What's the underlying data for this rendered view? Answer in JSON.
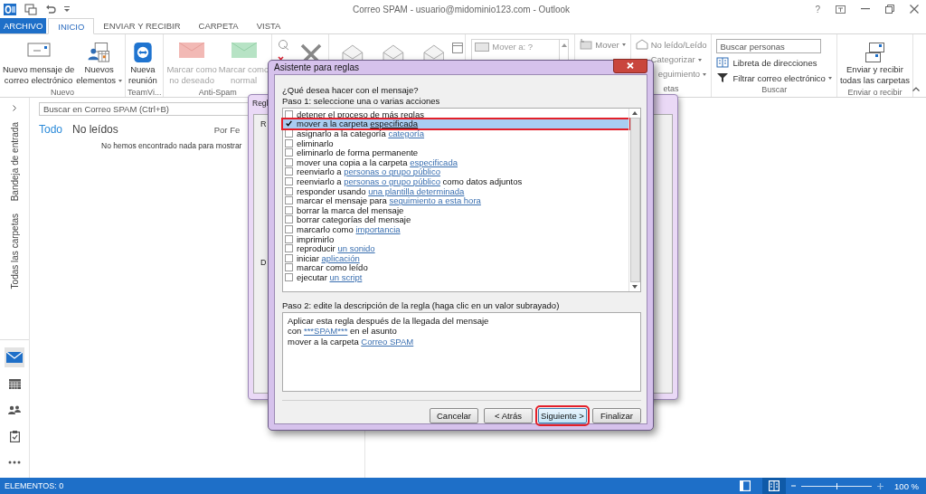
{
  "window": {
    "title": "Correo SPAM - usuario@midominio123.com - Outlook",
    "help": "?"
  },
  "tabs": [
    {
      "label": "ARCHIVO",
      "kind": "backstage",
      "selected": false
    },
    {
      "label": "INICIO",
      "kind": "tab",
      "selected": true
    },
    {
      "label": "ENVIAR Y RECIBIR",
      "kind": "tab",
      "selected": false
    },
    {
      "label": "CARPETA",
      "kind": "tab",
      "selected": false
    },
    {
      "label": "VISTA",
      "kind": "tab",
      "selected": false
    }
  ],
  "ribbon": [
    {
      "kind": "large",
      "label": "Nuevo",
      "buttons": [
        {
          "lines": [
            "Nuevo mensaje de",
            "correo electrónico"
          ],
          "dropdown": false,
          "disabled": false
        },
        {
          "lines": [
            "Nuevos",
            "elementos"
          ],
          "dropdown": true,
          "disabled": false
        }
      ]
    },
    {
      "kind": "large",
      "label": "TeamVi...",
      "buttons": [
        {
          "lines": [
            "Nueva",
            "reunión"
          ],
          "dropdown": false,
          "disabled": false
        }
      ]
    },
    {
      "kind": "large",
      "label": "Anti-Spam",
      "buttons": [
        {
          "lines": [
            "Marcar como",
            "no deseado"
          ],
          "dropdown": false,
          "disabled": true
        },
        {
          "lines": [
            "Marcar como",
            "normal"
          ],
          "dropdown": false,
          "disabled": true
        }
      ]
    },
    {
      "kind": "delete"
    },
    {
      "kind": "respond"
    },
    {
      "kind": "quicksteps",
      "items": [
        "Mover a: ?"
      ]
    },
    {
      "kind": "small",
      "items": [
        {
          "label": "Mover",
          "dropdown": true
        }
      ]
    },
    {
      "kind": "small",
      "label": "etas",
      "items": [
        {
          "label": "No leído/Leído",
          "dropdown": false
        },
        {
          "label": "Categorizar",
          "dropdown": true
        },
        {
          "label": "eguimiento",
          "dropdown": true
        }
      ]
    },
    {
      "kind": "search",
      "label": "Buscar",
      "placeholder": "Buscar personas",
      "items": [
        {
          "label": "Libreta de direcciones",
          "dropdown": false
        },
        {
          "label": "Filtrar correo electrónico",
          "dropdown": true
        }
      ]
    },
    {
      "kind": "large",
      "label": "Enviar o recibir",
      "buttons": [
        {
          "lines": [
            "Enviar y recibir",
            "todas las carpetas"
          ],
          "dropdown": false,
          "disabled": false
        }
      ]
    }
  ],
  "sidebar": {
    "labels": [
      "Bandeja de entrada",
      "Todas las carpetas"
    ],
    "nav": [
      {
        "selected": true
      },
      {
        "selected": false
      },
      {
        "selected": false
      },
      {
        "selected": false
      },
      {
        "selected": false
      }
    ]
  },
  "message_list": {
    "search_placeholder": "Buscar en Correo SPAM (Ctrl+B)",
    "filters": [
      {
        "label": "Todo",
        "selected": true
      },
      {
        "label": "No leídos",
        "selected": false
      }
    ],
    "sort": "Por Fe",
    "empty": "No hemos encontrado nada para mostrar"
  },
  "background_dialog": {
    "title": "Regl",
    "labels": [
      "R",
      "D"
    ]
  },
  "dialog": {
    "title": "Asistente para reglas",
    "question": "¿Qué desea hacer con el mensaje?",
    "step1": "Paso 1: seleccione una o varias acciones",
    "actions": [
      {
        "checked": false,
        "selected": false,
        "annotated": false,
        "parts": [
          {
            "kind": "text",
            "text": "detener el proceso de más reglas"
          }
        ]
      },
      {
        "checked": true,
        "selected": true,
        "annotated": true,
        "parts": [
          {
            "kind": "text",
            "text": "mover a la carpeta "
          },
          {
            "kind": "link",
            "text": "especificada"
          }
        ]
      },
      {
        "checked": false,
        "selected": false,
        "annotated": false,
        "parts": [
          {
            "kind": "text",
            "text": "asignarlo a la categoría "
          },
          {
            "kind": "link",
            "text": "categoría"
          }
        ]
      },
      {
        "checked": false,
        "selected": false,
        "annotated": false,
        "parts": [
          {
            "kind": "text",
            "text": "eliminarlo"
          }
        ]
      },
      {
        "checked": false,
        "selected": false,
        "annotated": false,
        "parts": [
          {
            "kind": "text",
            "text": "eliminarlo de forma permanente"
          }
        ]
      },
      {
        "checked": false,
        "selected": false,
        "annotated": false,
        "parts": [
          {
            "kind": "text",
            "text": "mover una copia a la carpeta "
          },
          {
            "kind": "link",
            "text": "especificada"
          }
        ]
      },
      {
        "checked": false,
        "selected": false,
        "annotated": false,
        "parts": [
          {
            "kind": "text",
            "text": "reenviarlo a "
          },
          {
            "kind": "link",
            "text": "personas o grupo público"
          }
        ]
      },
      {
        "checked": false,
        "selected": false,
        "annotated": false,
        "parts": [
          {
            "kind": "text",
            "text": "reenviarlo a "
          },
          {
            "kind": "link",
            "text": "personas o grupo público"
          },
          {
            "kind": "text",
            "text": " como datos adjuntos"
          }
        ]
      },
      {
        "checked": false,
        "selected": false,
        "annotated": false,
        "parts": [
          {
            "kind": "text",
            "text": "responder usando "
          },
          {
            "kind": "link",
            "text": "una plantilla determinada"
          }
        ]
      },
      {
        "checked": false,
        "selected": false,
        "annotated": false,
        "parts": [
          {
            "kind": "text",
            "text": "marcar el mensaje para "
          },
          {
            "kind": "link",
            "text": "seguimiento a esta hora"
          }
        ]
      },
      {
        "checked": false,
        "selected": false,
        "annotated": false,
        "parts": [
          {
            "kind": "text",
            "text": "borrar la marca del mensaje"
          }
        ]
      },
      {
        "checked": false,
        "selected": false,
        "annotated": false,
        "parts": [
          {
            "kind": "text",
            "text": "borrar categorías del mensaje"
          }
        ]
      },
      {
        "checked": false,
        "selected": false,
        "annotated": false,
        "parts": [
          {
            "kind": "text",
            "text": "marcarlo como "
          },
          {
            "kind": "link",
            "text": "importancia"
          }
        ]
      },
      {
        "checked": false,
        "selected": false,
        "annotated": false,
        "parts": [
          {
            "kind": "text",
            "text": "imprimirlo"
          }
        ]
      },
      {
        "checked": false,
        "selected": false,
        "annotated": false,
        "parts": [
          {
            "kind": "text",
            "text": "reproducir "
          },
          {
            "kind": "link",
            "text": "un sonido"
          }
        ]
      },
      {
        "checked": false,
        "selected": false,
        "annotated": false,
        "parts": [
          {
            "kind": "text",
            "text": "iniciar "
          },
          {
            "kind": "link",
            "text": "aplicación"
          }
        ]
      },
      {
        "checked": false,
        "selected": false,
        "annotated": false,
        "parts": [
          {
            "kind": "text",
            "text": "marcar como leído"
          }
        ]
      },
      {
        "checked": false,
        "selected": false,
        "annotated": false,
        "parts": [
          {
            "kind": "text",
            "text": "ejecutar "
          },
          {
            "kind": "link",
            "text": "un script"
          }
        ]
      }
    ],
    "step2": "Paso 2: edite la descripción de la regla (haga clic en un valor subrayado)",
    "description": [
      [
        {
          "kind": "text",
          "text": "Aplicar esta regla después de la llegada del mensaje"
        }
      ],
      [
        {
          "kind": "text",
          "text": "con "
        },
        {
          "kind": "link",
          "text": "***SPAM***"
        },
        {
          "kind": "text",
          "text": " en el asunto"
        }
      ],
      [
        {
          "kind": "text",
          "text": "mover a la carpeta "
        },
        {
          "kind": "link",
          "text": "Correo SPAM"
        }
      ]
    ],
    "buttons": [
      {
        "label": "Cancelar",
        "focused": false,
        "annotated": false
      },
      {
        "label": "< Atrás",
        "focused": false,
        "annotated": false
      },
      {
        "label": "Siguiente >",
        "focused": true,
        "annotated": true
      },
      {
        "label": "Finalizar",
        "focused": false,
        "annotated": false
      }
    ]
  },
  "status_bar": {
    "text": "ELEMENTOS: 0",
    "views": [
      {
        "selected": false
      },
      {
        "selected": true
      }
    ],
    "zoom": {
      "level": 0.5,
      "reading": "100 %"
    }
  }
}
